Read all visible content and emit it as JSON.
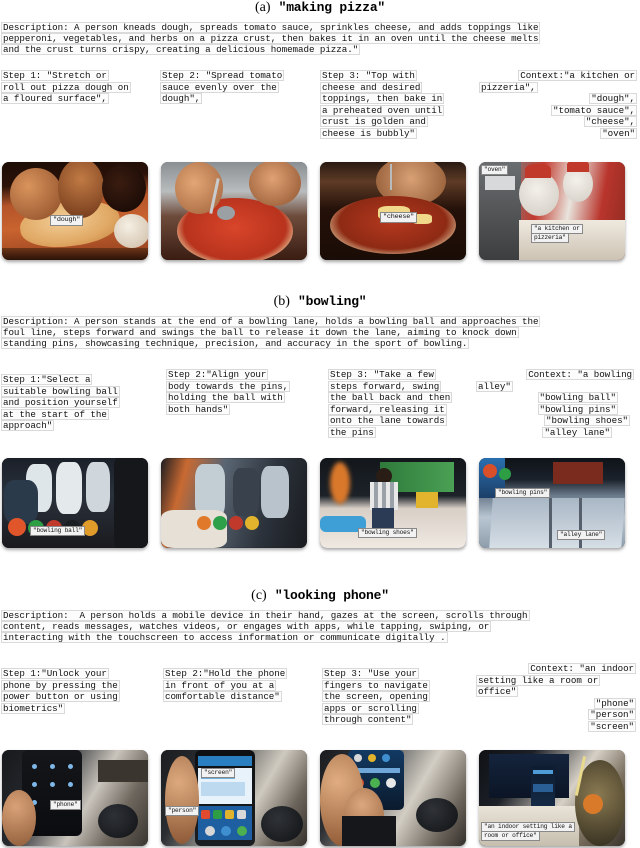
{
  "sections": [
    {
      "label": "(a)",
      "title": "\"making pizza\"",
      "description": [
        "Description: A person kneads dough, spreads tomato sauce, sprinkles cheese, and adds toppings like",
        "pepperoni, vegetables, and herbs on a pizza crust, then bakes it in an oven until the cheese melts",
        "and the crust turns crispy, creating a delicious homemade pizza.\""
      ],
      "steps": [
        [
          "Step 1: \"Stretch or",
          "roll out pizza dough on",
          "a floured surface\","
        ],
        [
          "Step 2: \"Spread tomato",
          "sauce evenly over the",
          "dough\","
        ],
        [
          "Step 3: \"Top with",
          "cheese and desired",
          "toppings, then bake in",
          "a preheated oven until",
          "crust is golden and",
          "cheese is bubbly\""
        ],
        [
          "Context:\"a kitchen or",
          "pizzeria\",",
          "\"dough\",",
          "\"tomato sauce\",",
          "\"cheese\",",
          "\"oven\""
        ]
      ],
      "captions": [
        [
          "\"dough\""
        ],
        [],
        [
          "\"cheese\""
        ],
        [
          "\"oven\"",
          "\"a kitchen or",
          "pizzeria\""
        ]
      ]
    },
    {
      "label": "(b)",
      "title": "\"bowling\"",
      "description": [
        "Description: A person stands at the end of a bowling lane, holds a bowling ball and approaches the",
        "foul line, steps forward and swings the ball to release it down the lane, aiming to knock down",
        "standing pins, showcasing technique, precision, and accuracy in the sport of bowling."
      ],
      "steps": [
        [
          "Step 1:\"Select a",
          "suitable bowling ball",
          "and position yourself",
          "at the start of the",
          "approach\""
        ],
        [
          "Step 2:\"Align your",
          "body towards the pins,",
          "holding the ball with",
          "both hands\""
        ],
        [
          "Step 3: \"Take a few",
          "steps forward, swing",
          "the ball back and then",
          "forward, releasing it",
          "onto the lane towards",
          "the pins"
        ],
        [
          "Context: \"a bowling",
          "alley\"",
          "\"bowling ball\"",
          "\"bowling pins\"",
          "\"bowling shoes\"",
          "\"alley lane\""
        ]
      ],
      "captions": [
        [
          "\"bowling ball\""
        ],
        [],
        [
          "\"bowling shoes\""
        ],
        [
          "\"bowling pins\"",
          "\"alley lane\""
        ]
      ]
    },
    {
      "label": "(c)",
      "title": "\"looking phone\"",
      "description": [
        "Description:  A person holds a mobile device in their hand, gazes at the screen, scrolls through",
        "content, reads messages, watches videos, or engages with apps, while tapping, swiping, or",
        "interacting with the touchscreen to access information or communicate digitally ."
      ],
      "steps": [
        [
          "Step 1:\"Unlock your",
          "phone by pressing the",
          "power button or using",
          "biometrics\""
        ],
        [
          "Step 2:\"Hold the phone",
          "in front of you at a",
          "comfortable distance\""
        ],
        [
          "Step 3: \"Use your",
          "fingers to navigate",
          "the screen, opening",
          "apps or scrolling",
          "through content\""
        ],
        [
          "Context: \"an indoor",
          "setting like a room or",
          "office\"",
          "\"phone\"",
          "\"person\"",
          "\"screen\""
        ]
      ],
      "captions": [
        [
          "\"phone\""
        ],
        [
          "\"screen\"",
          "\"person\""
        ],
        [],
        [
          "\"an indoor setting like a",
          "room or office\""
        ]
      ]
    }
  ],
  "colors": {
    "text": "#111111",
    "box_border": "#d9d9d9",
    "box_fill": "#fcfcfc",
    "caption_fill": "#f2f2f2",
    "caption_border": "#888888"
  }
}
